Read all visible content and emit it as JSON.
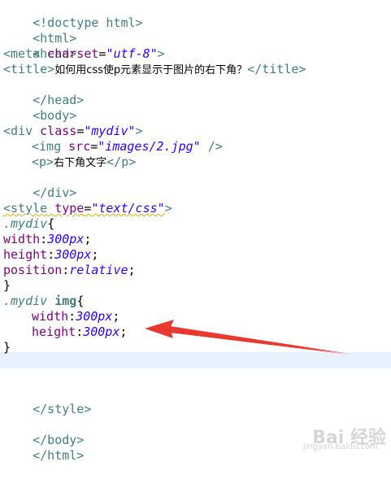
{
  "code": {
    "l1": "<!doctype html>",
    "l2": "<html>",
    "l3": "<head>",
    "l4_tag": "<meta",
    "l4_attr": "charset",
    "l4_val": "\"utf-8\"",
    "l4_end": ">",
    "l5_open": "<title>",
    "l5_text": "如何用css使p元素显示于图片的右下角？",
    "l5_close": "</title>",
    "l6": "</head>",
    "l7": "<body>",
    "l9_tag": "<div",
    "l9_attr": "class",
    "l9_val": "\"mydiv\"",
    "l9_end": ">",
    "l10_tag": "<img",
    "l10_attr": "src",
    "l10_val": "\"images/2.jpg\"",
    "l10_end": "/>",
    "l11_open": "<p>",
    "l11_text": "右下角文字",
    "l11_close": "</p>",
    "l12": "</div>",
    "l14_tag": "<style",
    "l14_attr": "type",
    "l14_val": "\"text/css\"",
    "l14_end": ">",
    "l15_sel": ".mydiv",
    "l15_brace": "{",
    "l16_prop": "width",
    "l16_val": "300px",
    "l17_prop": "height",
    "l17_val": "300px",
    "l18_prop": "position",
    "l18_val": "relative",
    "l19": "}",
    "l20_sel": ".mydiv",
    "l20_el": "img",
    "l20_brace": "{",
    "l21_prop": "width",
    "l21_val": "300px",
    "l22_prop": "height",
    "l22_val": "300px",
    "l23": "}",
    "l26": "</style>",
    "l28": "</body>",
    "l29": "</html>"
  },
  "colors": {
    "tag": "#3f7f7f",
    "attribute": "#7f007f",
    "value": "#2a00ff",
    "current_line": "#e8f2fe",
    "arrow": "#e8392e"
  },
  "watermark": {
    "main": "Bai 经验",
    "sub": "jingyan.baidu.com"
  }
}
